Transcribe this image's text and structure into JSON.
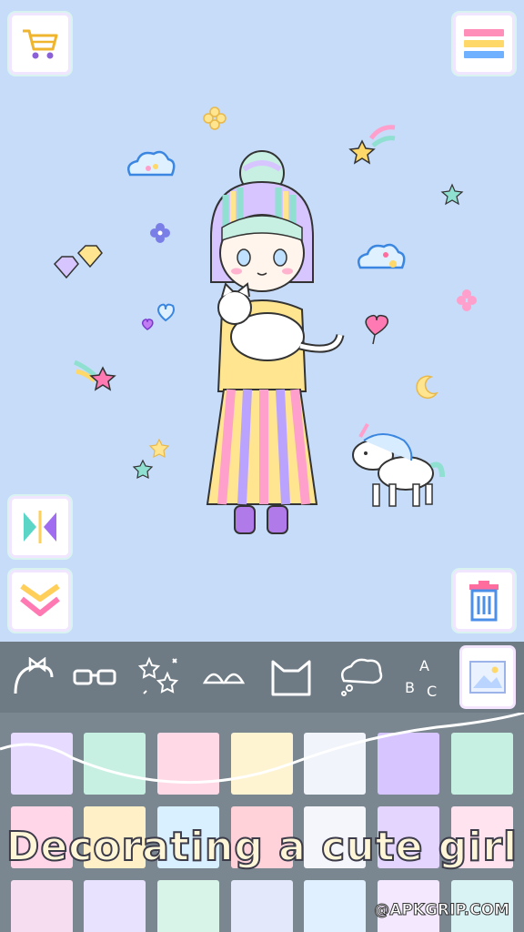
{
  "caption": "Decorating a cute girl",
  "watermark": "@APKGRIP.COM",
  "colors": {
    "background": "#c6dcf9",
    "toolbar": "#6f7b84",
    "panel": "#7b8790"
  },
  "swatches_row1": [
    "#e7dcff",
    "#c8f0e2",
    "#ffd9e6",
    "#fff4d2",
    "#f1f4fb",
    "#d7c5ff",
    "#c5f0e2"
  ],
  "swatches_row2": [
    "#ffd6e8",
    "#fff0c8",
    "#d8f0ff",
    "#ffd1d8",
    "#f4f6fb",
    "#e4d5ff",
    "#ffe3ef"
  ],
  "swatches_row3": [
    "#f7ddf0",
    "#e8e2ff",
    "#d8f4e8",
    "#e3e8fb",
    "#e0f0ff",
    "#f4e8ff",
    "#d9f2f4"
  ]
}
